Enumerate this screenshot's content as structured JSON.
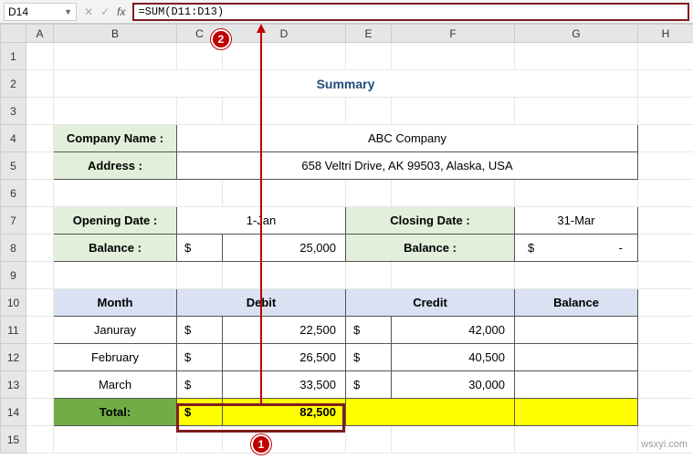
{
  "nameBox": "D14",
  "formula": "=SUM(D11:D13)",
  "columns": [
    "A",
    "B",
    "C",
    "D",
    "E",
    "F",
    "G",
    "H"
  ],
  "rows": [
    "1",
    "2",
    "3",
    "4",
    "5",
    "6",
    "7",
    "8",
    "9",
    "10",
    "11",
    "12",
    "13",
    "14",
    "15"
  ],
  "summaryTitle": "Summary",
  "companyNameLabel": "Company Name :",
  "companyName": "ABC Company",
  "addressLabel": "Address :",
  "address": "658 Veltri Drive, AK 99503, Alaska, USA",
  "openingDateLabel": "Opening Date :",
  "openingDate": "1-Jan",
  "closingDateLabel": "Closing Date :",
  "closingDate": "31-Mar",
  "balanceLabel": "Balance :",
  "openingBalanceDollar": "$",
  "openingBalance": "25,000",
  "closingBalanceDollar": "$",
  "closingBalance": "-",
  "tableHeaders": {
    "month": "Month",
    "debit": "Debit",
    "credit": "Credit",
    "balance": "Balance"
  },
  "monthsData": [
    {
      "month": "Januray",
      "dSym": "$",
      "debit": "22,500",
      "cSym": "$",
      "credit": "42,000",
      "balance": ""
    },
    {
      "month": "February",
      "dSym": "$",
      "debit": "26,500",
      "cSym": "$",
      "credit": "40,500",
      "balance": ""
    },
    {
      "month": "March",
      "dSym": "$",
      "debit": "33,500",
      "cSym": "$",
      "credit": "30,000",
      "balance": ""
    }
  ],
  "totalLabel": "Total:",
  "totalDebitSym": "$",
  "totalDebit": "82,500",
  "totalCredit": "",
  "totalBalance": "",
  "callouts": {
    "c1": "1",
    "c2": "2"
  },
  "watermark": "wsxyi.com"
}
